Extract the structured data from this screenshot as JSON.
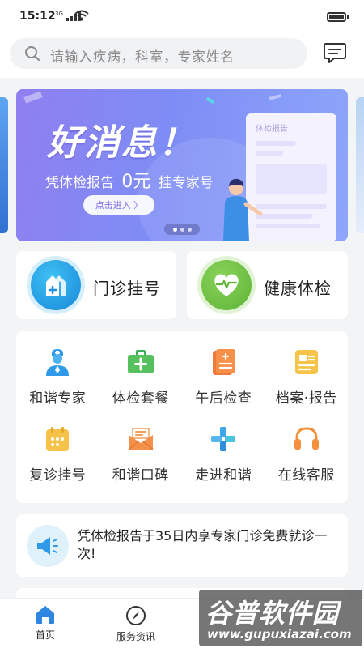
{
  "status_bar": {
    "time": "15:12",
    "network": "3G"
  },
  "header": {
    "search_placeholder": "请输入疾病，科室，专家姓名",
    "message_icon": "chat-message-icon"
  },
  "banner": {
    "headline": "好消息！",
    "subtitle_prefix": "凭体检报告",
    "subtitle_amount": "0元",
    "subtitle_suffix": "挂专家号",
    "cta": "点击进入 〉",
    "report_title": "体检报告",
    "page_count": 3,
    "current_page": 1
  },
  "quick_actions": [
    {
      "label": "门诊挂号",
      "icon": "outpatient-register-icon",
      "color": "#1e97e3"
    },
    {
      "label": "健康体检",
      "icon": "health-check-heart-icon",
      "color": "#6cc144"
    }
  ],
  "services": [
    {
      "label": "和谐专家",
      "icon": "doctor-icon"
    },
    {
      "label": "体检套餐",
      "icon": "medical-kit-icon"
    },
    {
      "label": "午后检查",
      "icon": "checklist-icon"
    },
    {
      "label": "档案·报告",
      "icon": "report-file-icon"
    },
    {
      "label": "复诊挂号",
      "icon": "calendar-icon"
    },
    {
      "label": "和谐口碑",
      "icon": "mail-review-icon"
    },
    {
      "label": "走进和谐",
      "icon": "hospital-cross-icon"
    },
    {
      "label": "在线客服",
      "icon": "headset-icon"
    }
  ],
  "notice": {
    "icon": "megaphone-icon",
    "text": "凭体检报告于35日内享专家门诊免费就诊一次!"
  },
  "tab_bar": {
    "tabs": [
      {
        "label": "首页",
        "icon": "home-icon",
        "active": true
      },
      {
        "label": "服务资讯",
        "icon": "compass-icon",
        "active": false
      }
    ]
  },
  "watermark": {
    "line1": "谷普软件园",
    "line2": "www.gupuxiazai.com"
  },
  "colors": {
    "accent": "#1e97e3",
    "banner_start": "#8f7ff0",
    "banner_end": "#8ea6fa",
    "page_bg": "#f3f4f6"
  }
}
